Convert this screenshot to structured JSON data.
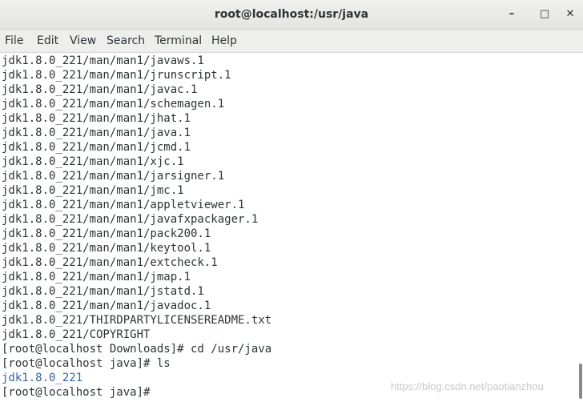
{
  "window": {
    "title": "root@localhost:/usr/java",
    "minimize": "–",
    "maximize": "□",
    "close": "✕"
  },
  "menu": [
    "File",
    "Edit",
    "View",
    "Search",
    "Terminal",
    "Help"
  ],
  "terminal": {
    "lines": [
      "jdk1.8.0_221/man/man1/javaws.1",
      "jdk1.8.0_221/man/man1/jrunscript.1",
      "jdk1.8.0_221/man/man1/javac.1",
      "jdk1.8.0_221/man/man1/schemagen.1",
      "jdk1.8.0_221/man/man1/jhat.1",
      "jdk1.8.0_221/man/man1/java.1",
      "jdk1.8.0_221/man/man1/jcmd.1",
      "jdk1.8.0_221/man/man1/xjc.1",
      "jdk1.8.0_221/man/man1/jarsigner.1",
      "jdk1.8.0_221/man/man1/jmc.1",
      "jdk1.8.0_221/man/man1/appletviewer.1",
      "jdk1.8.0_221/man/man1/javafxpackager.1",
      "jdk1.8.0_221/man/man1/pack200.1",
      "jdk1.8.0_221/man/man1/keytool.1",
      "jdk1.8.0_221/man/man1/extcheck.1",
      "jdk1.8.0_221/man/man1/jmap.1",
      "jdk1.8.0_221/man/man1/jstatd.1",
      "jdk1.8.0_221/man/man1/javadoc.1",
      "jdk1.8.0_221/THIRDPARTYLICENSEREADME.txt",
      "jdk1.8.0_221/COPYRIGHT",
      "[root@localhost Downloads]# cd /usr/java",
      "[root@localhost java]# ls",
      "jdk1.8.0_221",
      "[root@localhost java]#"
    ],
    "directory_color": "#3465a4",
    "text_color": "#2e3436"
  },
  "watermark": "https://blog.csdn.net/paotianzhou"
}
